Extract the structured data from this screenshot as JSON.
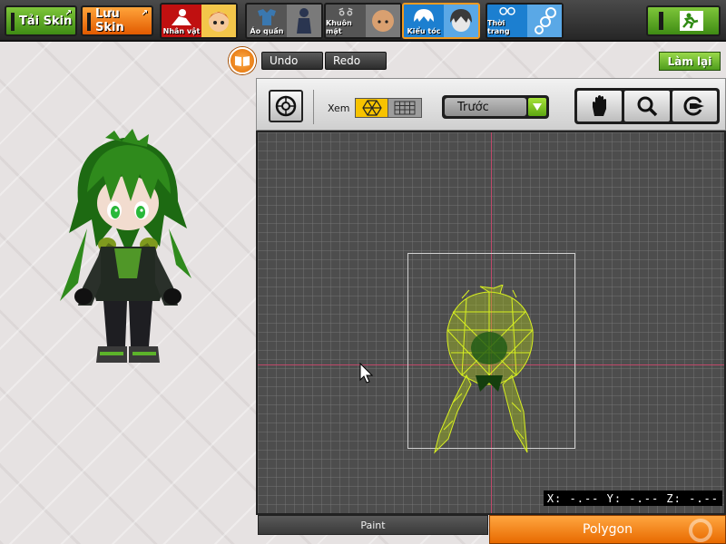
{
  "topbar": {
    "load_skin": "Tải Skin",
    "save_skin": "Lưu Skin",
    "categories": [
      {
        "label": "Nhân vật",
        "icon": "character-icon",
        "active": false,
        "color": "#d51616"
      },
      {
        "label": "Áo quần",
        "icon": "clothes-icon",
        "active": false,
        "color": "#707070"
      },
      {
        "label": "Khuôn mặt",
        "icon": "face-icon",
        "active": false,
        "color": "#707070"
      },
      {
        "label": "Kiểu tóc",
        "icon": "hair-icon",
        "active": true,
        "color": "#1f88d6"
      },
      {
        "label": "Thời trang",
        "icon": "accessory-icon",
        "active": false,
        "color": "#1f88d6"
      }
    ],
    "exit_icon": "exit-icon"
  },
  "history": {
    "undo": "Undo",
    "redo": "Redo",
    "reset": "Làm lại"
  },
  "toolbar": {
    "view_label": "Xem",
    "view_mode": "Trước",
    "tools": [
      "hand-icon",
      "zoom-icon",
      "rotate-icon"
    ]
  },
  "viewport": {
    "coords": "X: -.-- Y: -.-- Z: -.--"
  },
  "tabs": {
    "paint": "Paint",
    "polygon": "Polygon"
  },
  "colors": {
    "accent_orange": "#e86a00",
    "accent_green": "#5da612",
    "wireframe": "#d8f020",
    "axis": "#c0486a"
  }
}
